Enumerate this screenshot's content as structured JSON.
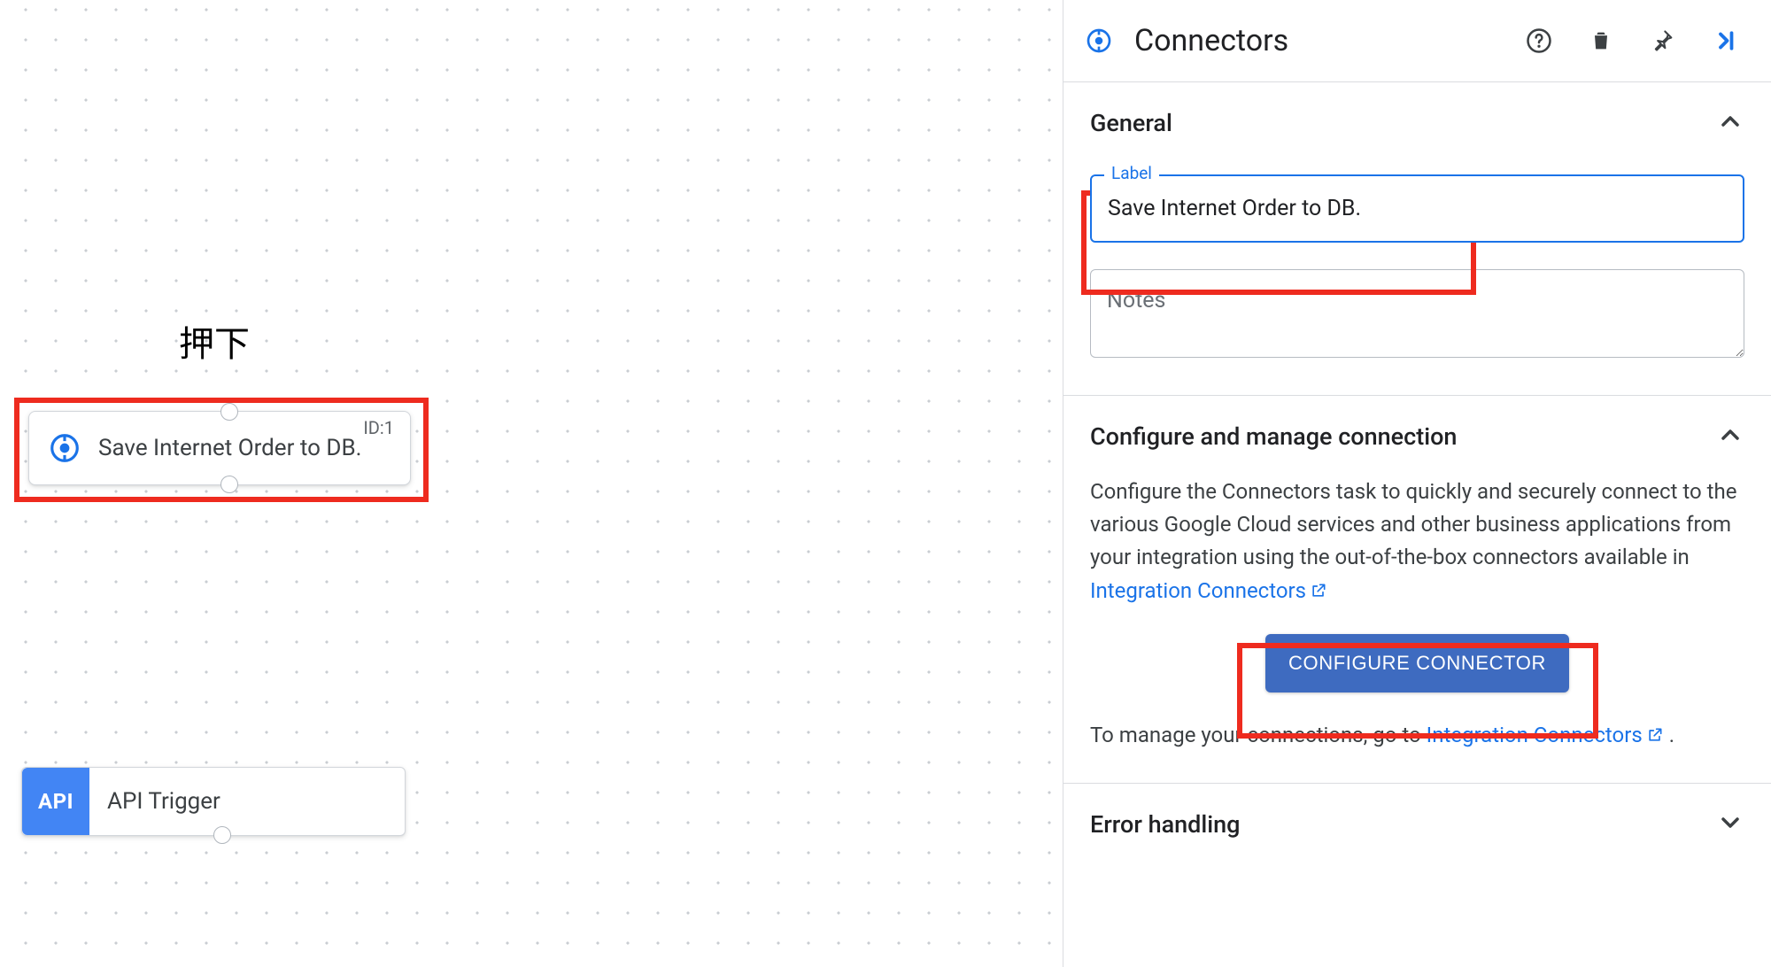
{
  "canvas": {
    "annotation_label": "押下",
    "connector_node": {
      "id_label": "ID:1",
      "title": "Save Internet Order to DB."
    },
    "api_node": {
      "badge": "API",
      "title": "API Trigger"
    }
  },
  "panel": {
    "title": "Connectors",
    "sections": {
      "general": {
        "title": "General",
        "label_field_label": "Label",
        "label_value": "Save Internet Order to DB.",
        "notes_placeholder": "Notes"
      },
      "configure": {
        "title": "Configure and manage connection",
        "description_pre": "Configure the Connectors task to quickly and securely connect to the various Google Cloud services and other business applications from your integration using the out-of-the-box connectors available in ",
        "description_link": "Integration Connectors",
        "button_label": "CONFIGURE CONNECTOR",
        "manage_pre": "To manage your connections, go to ",
        "manage_link": "Integration Connectors",
        "manage_post": " ."
      },
      "error": {
        "title": "Error handling"
      }
    }
  }
}
